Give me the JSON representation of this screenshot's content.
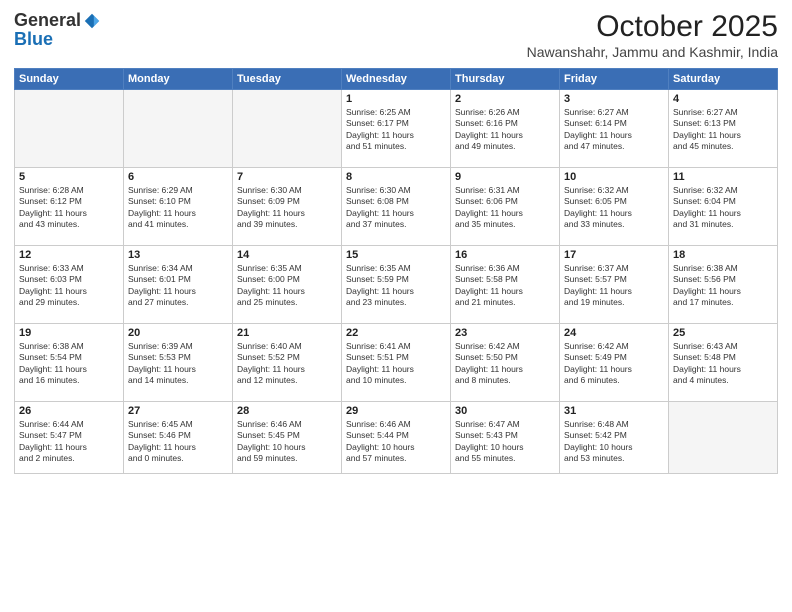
{
  "logo": {
    "general": "General",
    "blue": "Blue"
  },
  "header": {
    "month": "October 2025",
    "location": "Nawanshahr, Jammu and Kashmir, India"
  },
  "weekdays": [
    "Sunday",
    "Monday",
    "Tuesday",
    "Wednesday",
    "Thursday",
    "Friday",
    "Saturday"
  ],
  "weeks": [
    [
      {
        "day": "",
        "text": ""
      },
      {
        "day": "",
        "text": ""
      },
      {
        "day": "",
        "text": ""
      },
      {
        "day": "1",
        "text": "Sunrise: 6:25 AM\nSunset: 6:17 PM\nDaylight: 11 hours\nand 51 minutes."
      },
      {
        "day": "2",
        "text": "Sunrise: 6:26 AM\nSunset: 6:16 PM\nDaylight: 11 hours\nand 49 minutes."
      },
      {
        "day": "3",
        "text": "Sunrise: 6:27 AM\nSunset: 6:14 PM\nDaylight: 11 hours\nand 47 minutes."
      },
      {
        "day": "4",
        "text": "Sunrise: 6:27 AM\nSunset: 6:13 PM\nDaylight: 11 hours\nand 45 minutes."
      }
    ],
    [
      {
        "day": "5",
        "text": "Sunrise: 6:28 AM\nSunset: 6:12 PM\nDaylight: 11 hours\nand 43 minutes."
      },
      {
        "day": "6",
        "text": "Sunrise: 6:29 AM\nSunset: 6:10 PM\nDaylight: 11 hours\nand 41 minutes."
      },
      {
        "day": "7",
        "text": "Sunrise: 6:30 AM\nSunset: 6:09 PM\nDaylight: 11 hours\nand 39 minutes."
      },
      {
        "day": "8",
        "text": "Sunrise: 6:30 AM\nSunset: 6:08 PM\nDaylight: 11 hours\nand 37 minutes."
      },
      {
        "day": "9",
        "text": "Sunrise: 6:31 AM\nSunset: 6:06 PM\nDaylight: 11 hours\nand 35 minutes."
      },
      {
        "day": "10",
        "text": "Sunrise: 6:32 AM\nSunset: 6:05 PM\nDaylight: 11 hours\nand 33 minutes."
      },
      {
        "day": "11",
        "text": "Sunrise: 6:32 AM\nSunset: 6:04 PM\nDaylight: 11 hours\nand 31 minutes."
      }
    ],
    [
      {
        "day": "12",
        "text": "Sunrise: 6:33 AM\nSunset: 6:03 PM\nDaylight: 11 hours\nand 29 minutes."
      },
      {
        "day": "13",
        "text": "Sunrise: 6:34 AM\nSunset: 6:01 PM\nDaylight: 11 hours\nand 27 minutes."
      },
      {
        "day": "14",
        "text": "Sunrise: 6:35 AM\nSunset: 6:00 PM\nDaylight: 11 hours\nand 25 minutes."
      },
      {
        "day": "15",
        "text": "Sunrise: 6:35 AM\nSunset: 5:59 PM\nDaylight: 11 hours\nand 23 minutes."
      },
      {
        "day": "16",
        "text": "Sunrise: 6:36 AM\nSunset: 5:58 PM\nDaylight: 11 hours\nand 21 minutes."
      },
      {
        "day": "17",
        "text": "Sunrise: 6:37 AM\nSunset: 5:57 PM\nDaylight: 11 hours\nand 19 minutes."
      },
      {
        "day": "18",
        "text": "Sunrise: 6:38 AM\nSunset: 5:56 PM\nDaylight: 11 hours\nand 17 minutes."
      }
    ],
    [
      {
        "day": "19",
        "text": "Sunrise: 6:38 AM\nSunset: 5:54 PM\nDaylight: 11 hours\nand 16 minutes."
      },
      {
        "day": "20",
        "text": "Sunrise: 6:39 AM\nSunset: 5:53 PM\nDaylight: 11 hours\nand 14 minutes."
      },
      {
        "day": "21",
        "text": "Sunrise: 6:40 AM\nSunset: 5:52 PM\nDaylight: 11 hours\nand 12 minutes."
      },
      {
        "day": "22",
        "text": "Sunrise: 6:41 AM\nSunset: 5:51 PM\nDaylight: 11 hours\nand 10 minutes."
      },
      {
        "day": "23",
        "text": "Sunrise: 6:42 AM\nSunset: 5:50 PM\nDaylight: 11 hours\nand 8 minutes."
      },
      {
        "day": "24",
        "text": "Sunrise: 6:42 AM\nSunset: 5:49 PM\nDaylight: 11 hours\nand 6 minutes."
      },
      {
        "day": "25",
        "text": "Sunrise: 6:43 AM\nSunset: 5:48 PM\nDaylight: 11 hours\nand 4 minutes."
      }
    ],
    [
      {
        "day": "26",
        "text": "Sunrise: 6:44 AM\nSunset: 5:47 PM\nDaylight: 11 hours\nand 2 minutes."
      },
      {
        "day": "27",
        "text": "Sunrise: 6:45 AM\nSunset: 5:46 PM\nDaylight: 11 hours\nand 0 minutes."
      },
      {
        "day": "28",
        "text": "Sunrise: 6:46 AM\nSunset: 5:45 PM\nDaylight: 10 hours\nand 59 minutes."
      },
      {
        "day": "29",
        "text": "Sunrise: 6:46 AM\nSunset: 5:44 PM\nDaylight: 10 hours\nand 57 minutes."
      },
      {
        "day": "30",
        "text": "Sunrise: 6:47 AM\nSunset: 5:43 PM\nDaylight: 10 hours\nand 55 minutes."
      },
      {
        "day": "31",
        "text": "Sunrise: 6:48 AM\nSunset: 5:42 PM\nDaylight: 10 hours\nand 53 minutes."
      },
      {
        "day": "",
        "text": ""
      }
    ]
  ]
}
